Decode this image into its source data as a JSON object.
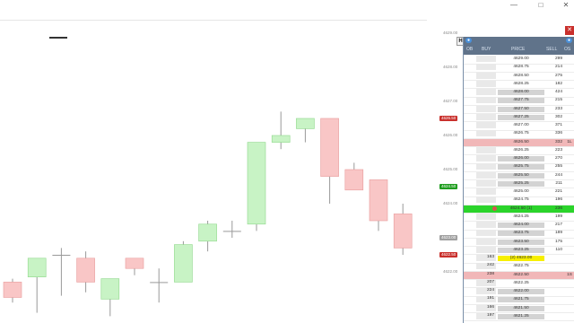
{
  "window": {
    "minimize_glyph": "—",
    "maximize_glyph": "□",
    "close_glyph": "✕"
  },
  "colors": {
    "bull_fill": "#c8f3c5",
    "bull_stroke": "#8fd88b",
    "bear_fill": "#f9c6c6",
    "bear_stroke": "#e89b9b",
    "wick": "#999999",
    "ladder_header": "#60738a",
    "current_row": "#2bd42b",
    "sell_highlight": "#f1b7b8",
    "buy_highlight": "#f7ef00"
  },
  "axis": {
    "labels": [
      {
        "text": "4629.00",
        "price": 4629.0
      },
      {
        "text": "4628.00",
        "price": 4628.0
      },
      {
        "text": "4627.00",
        "price": 4627.0
      },
      {
        "text": "4626.00",
        "price": 4626.0
      },
      {
        "text": "4625.00",
        "price": 4625.0
      },
      {
        "text": "4624.00",
        "price": 4624.0
      },
      {
        "text": "4623.00",
        "price": 4623.0
      },
      {
        "text": "4622.00",
        "price": 4622.0
      }
    ],
    "tags": [
      {
        "text": "4626.50",
        "price": 4626.5,
        "color": "#c9302c"
      },
      {
        "text": "4624.50",
        "price": 4624.5,
        "color": "#1f9d1f"
      },
      {
        "text": "4623.00",
        "price": 4623.0,
        "color": "#a0a0a0"
      },
      {
        "text": "4622.50",
        "price": 4622.5,
        "color": "#c9302c"
      }
    ]
  },
  "ladder": {
    "h_button": "H",
    "columns": {
      "ob": "OB",
      "buy": "BUY",
      "price": "PRICE",
      "sell": "SELL",
      "os": "OS"
    },
    "rows": [
      {
        "price": "4629.00",
        "buy": "",
        "sell": "299",
        "os": "",
        "style": ""
      },
      {
        "price": "4628.75",
        "buy": "",
        "sell": "214",
        "os": "",
        "style": ""
      },
      {
        "price": "4628.50",
        "buy": "",
        "sell": "275",
        "os": "",
        "style": ""
      },
      {
        "price": "4628.25",
        "buy": "",
        "sell": "182",
        "os": "",
        "style": ""
      },
      {
        "price": "4628.00",
        "buy": "",
        "sell": "424",
        "os": "",
        "style": "gray"
      },
      {
        "price": "4627.75",
        "buy": "",
        "sell": "215",
        "os": "",
        "style": "gray"
      },
      {
        "price": "4627.50",
        "buy": "",
        "sell": "233",
        "os": "",
        "style": "gray"
      },
      {
        "price": "4627.25",
        "buy": "",
        "sell": "302",
        "os": "",
        "style": "gray"
      },
      {
        "price": "4627.00",
        "buy": "",
        "sell": "371",
        "os": "",
        "style": ""
      },
      {
        "price": "4626.75",
        "buy": "",
        "sell": "336",
        "os": "",
        "style": ""
      },
      {
        "price": "4626.50",
        "buy": "",
        "sell": "332",
        "os": "1L",
        "style": "pink"
      },
      {
        "price": "4626.25",
        "buy": "",
        "sell": "223",
        "os": "",
        "style": ""
      },
      {
        "price": "4626.00",
        "buy": "",
        "sell": "270",
        "os": "",
        "style": "gray"
      },
      {
        "price": "4625.75",
        "buy": "",
        "sell": "255",
        "os": "",
        "style": "gray"
      },
      {
        "price": "4625.50",
        "buy": "",
        "sell": "244",
        "os": "",
        "style": "gray"
      },
      {
        "price": "4625.25",
        "buy": "",
        "sell": "211",
        "os": "",
        "style": "gray"
      },
      {
        "price": "4625.00",
        "buy": "",
        "sell": "221",
        "os": "",
        "style": ""
      },
      {
        "price": "4624.75",
        "buy": "",
        "sell": "196",
        "os": "",
        "style": ""
      },
      {
        "price": "4624.50 (1)",
        "buy": "",
        "sell": "236",
        "os": "",
        "style": "current"
      },
      {
        "price": "4624.25",
        "buy": "",
        "sell": "199",
        "os": "",
        "style": ""
      },
      {
        "price": "4624.00",
        "buy": "",
        "sell": "217",
        "os": "",
        "style": "gray"
      },
      {
        "price": "4623.75",
        "buy": "",
        "sell": "189",
        "os": "",
        "style": "gray"
      },
      {
        "price": "4623.50",
        "buy": "",
        "sell": "175",
        "os": "",
        "style": "gray"
      },
      {
        "price": "4623.25",
        "buy": "",
        "sell": "110",
        "os": "",
        "style": "gray"
      },
      {
        "price": "(2) 4623.00",
        "buy": "163",
        "sell": "",
        "os": "",
        "style": "yellow"
      },
      {
        "price": "4622.75",
        "buy": "242",
        "sell": "",
        "os": "",
        "style": ""
      },
      {
        "price": "4622.50",
        "buy": "238",
        "sell": "",
        "os": "1S",
        "style": "pink"
      },
      {
        "price": "4622.25",
        "buy": "207",
        "sell": "",
        "os": "",
        "style": ""
      },
      {
        "price": "4622.00",
        "buy": "224",
        "sell": "",
        "os": "",
        "style": "gray"
      },
      {
        "price": "4621.75",
        "buy": "191",
        "sell": "",
        "os": "",
        "style": "gray"
      },
      {
        "price": "4621.50",
        "buy": "166",
        "sell": "",
        "os": "",
        "style": "gray"
      },
      {
        "price": "4621.25",
        "buy": "197",
        "sell": "",
        "os": "",
        "style": "gray"
      }
    ]
  },
  "candles": [
    {
      "o": 4621.7,
      "h": 4621.8,
      "l": 4621.1,
      "c": 4621.25
    },
    {
      "o": 4621.85,
      "h": 4622.2,
      "l": 4620.8,
      "c": 4622.4
    },
    {
      "o": 4622.5,
      "h": 4622.7,
      "l": 4621.3,
      "c": 4622.5
    },
    {
      "o": 4622.4,
      "h": 4622.6,
      "l": 4621.4,
      "c": 4621.7
    },
    {
      "o": 4621.2,
      "h": 4621.8,
      "l": 4620.7,
      "c": 4621.8
    },
    {
      "o": 4622.4,
      "h": 4622.4,
      "l": 4621.9,
      "c": 4622.1
    },
    {
      "o": 4621.7,
      "h": 4622.1,
      "l": 4621.1,
      "c": 4621.7
    },
    {
      "o": 4621.7,
      "h": 4622.9,
      "l": 4621.7,
      "c": 4622.8
    },
    {
      "o": 4622.9,
      "h": 4623.5,
      "l": 4622.6,
      "c": 4623.4
    },
    {
      "o": 4623.2,
      "h": 4623.5,
      "l": 4623.0,
      "c": 4623.2
    },
    {
      "o": 4623.4,
      "h": 4625.8,
      "l": 4623.2,
      "c": 4625.8
    },
    {
      "o": 4625.8,
      "h": 4626.7,
      "l": 4625.6,
      "c": 4626.0
    },
    {
      "o": 4626.2,
      "h": 4626.5,
      "l": 4625.8,
      "c": 4626.5
    },
    {
      "o": 4626.5,
      "h": 4626.5,
      "l": 4624.0,
      "c": 4624.8
    },
    {
      "o": 4625.0,
      "h": 4625.2,
      "l": 4624.4,
      "c": 4624.4
    },
    {
      "o": 4624.7,
      "h": 4624.7,
      "l": 4623.2,
      "c": 4623.5
    },
    {
      "o": 4623.7,
      "h": 4624.0,
      "l": 4622.5,
      "c": 4622.7
    }
  ]
}
